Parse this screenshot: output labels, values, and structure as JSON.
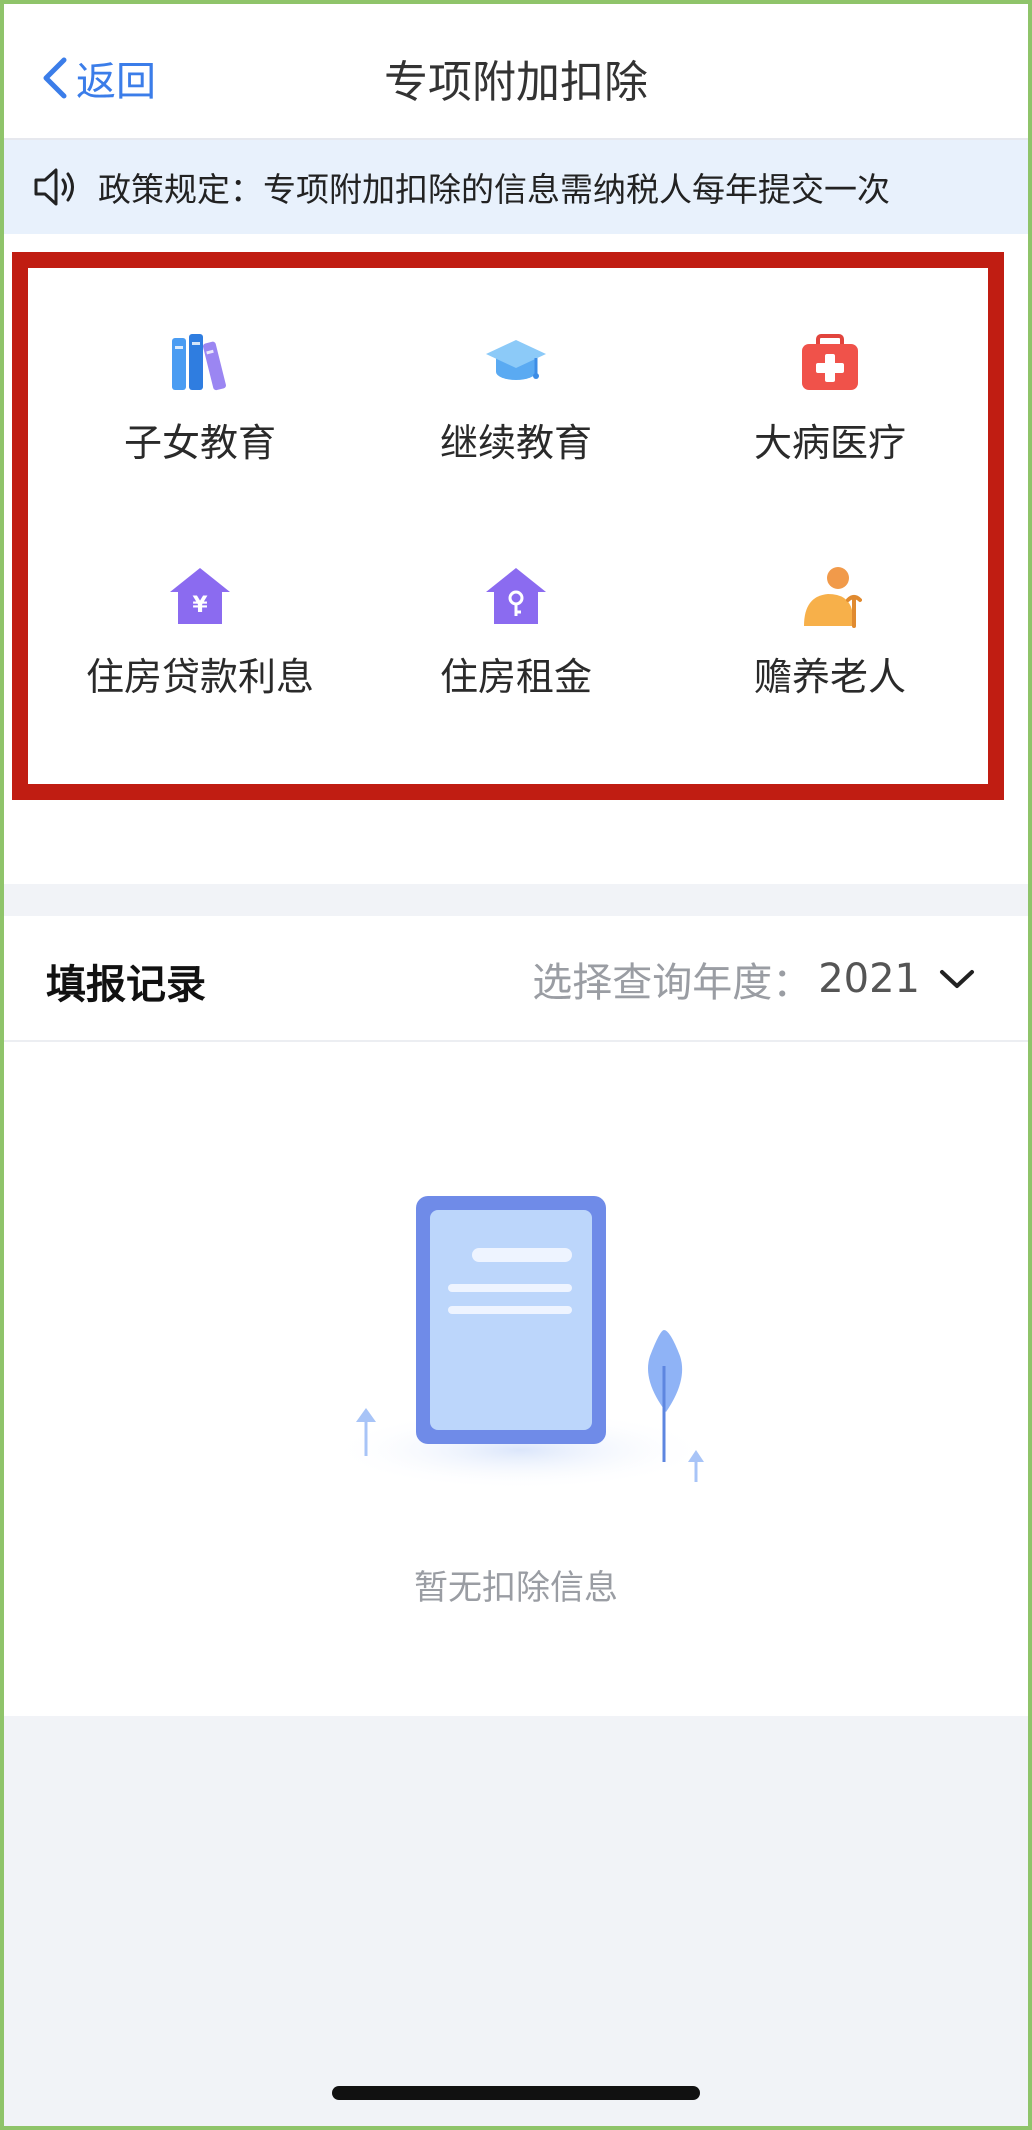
{
  "nav": {
    "back_label": "返回",
    "title": "专项附加扣除"
  },
  "notice": {
    "text": "政策规定：专项附加扣除的信息需纳税人每年提交一次",
    "icon": "speaker-icon"
  },
  "categories": [
    {
      "label": "子女教育",
      "icon": "books-icon"
    },
    {
      "label": "继续教育",
      "icon": "graduation-cap-icon"
    },
    {
      "label": "大病医疗",
      "icon": "medical-kit-icon"
    },
    {
      "label": "住房贷款利息",
      "icon": "house-yen-icon"
    },
    {
      "label": "住房租金",
      "icon": "house-key-icon"
    },
    {
      "label": "赡养老人",
      "icon": "elderly-person-icon"
    }
  ],
  "records": {
    "title": "填报记录",
    "year_label": "选择查询年度：",
    "year_value": "2021",
    "empty_text": "暂无扣除信息"
  },
  "colors": {
    "accent": "#3b7de9",
    "highlight": "#c01d12",
    "notice_bg": "#e8f1fc",
    "purple": "#8b6bf0",
    "red": "#f0524a",
    "orange": "#f6a63c"
  }
}
